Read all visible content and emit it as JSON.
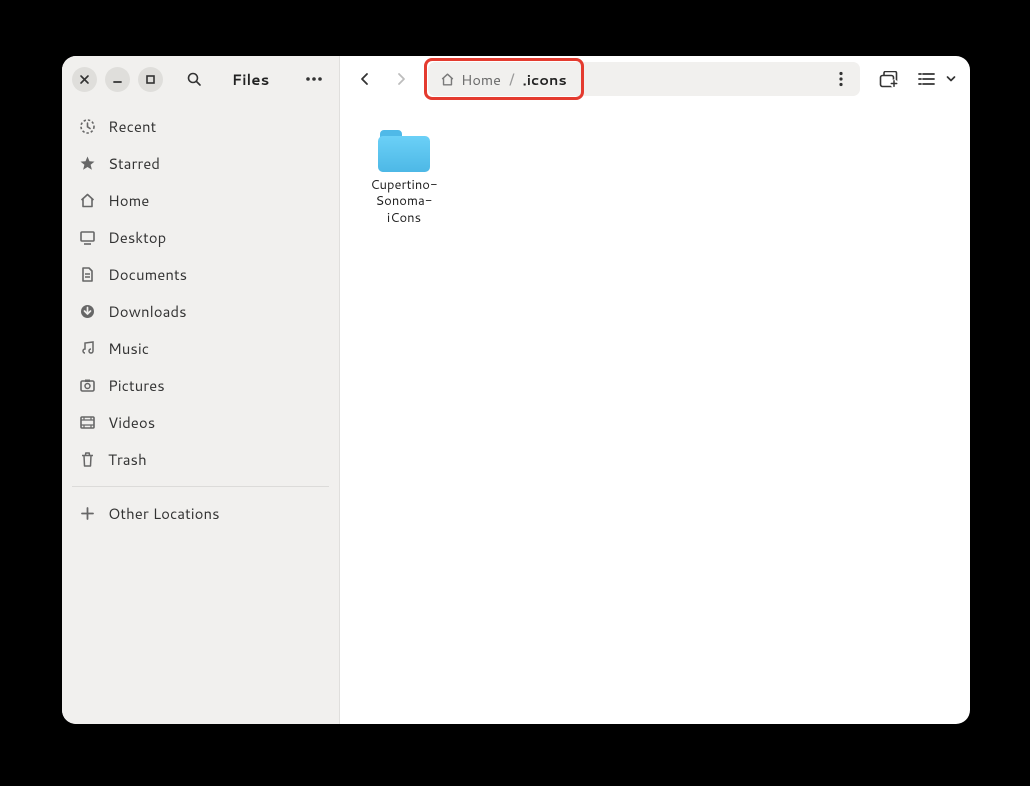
{
  "app_title": "Files",
  "sidebar": {
    "items": [
      {
        "label": "Recent",
        "icon": "recent"
      },
      {
        "label": "Starred",
        "icon": "star"
      },
      {
        "label": "Home",
        "icon": "home"
      },
      {
        "label": "Desktop",
        "icon": "desktop"
      },
      {
        "label": "Documents",
        "icon": "documents"
      },
      {
        "label": "Downloads",
        "icon": "downloads"
      },
      {
        "label": "Music",
        "icon": "music"
      },
      {
        "label": "Pictures",
        "icon": "pictures"
      },
      {
        "label": "Videos",
        "icon": "videos"
      },
      {
        "label": "Trash",
        "icon": "trash"
      }
    ],
    "other_locations_label": "Other Locations"
  },
  "breadcrumb": {
    "parent": "Home",
    "current": ".icons"
  },
  "contents": {
    "items": [
      {
        "name": "Cupertino-Sonoma-iCons",
        "type": "folder"
      }
    ]
  }
}
